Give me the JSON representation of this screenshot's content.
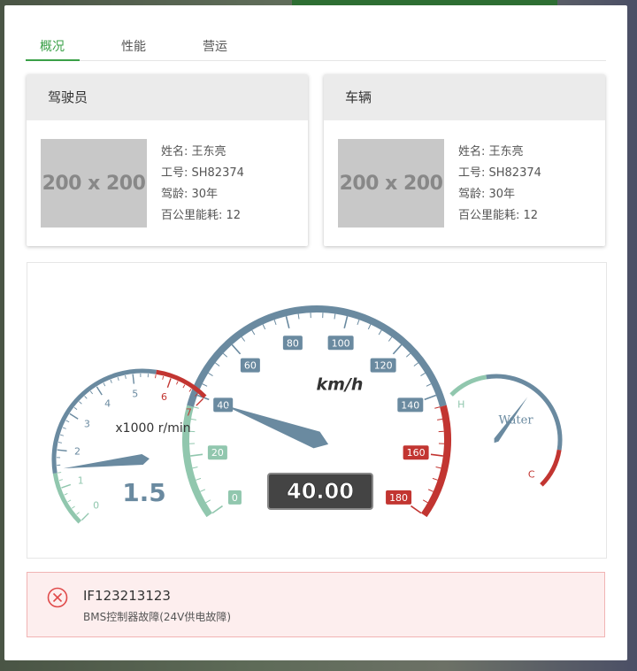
{
  "tabs": [
    {
      "label": "概况",
      "active": true
    },
    {
      "label": "性能",
      "active": false
    },
    {
      "label": "营运",
      "active": false
    }
  ],
  "driver_card": {
    "title": "驾驶员",
    "placeholder": "200 x 200",
    "fields": [
      "姓名: 王东亮",
      "工号: SH82374",
      "驾龄: 30年",
      "百公里能耗: 12"
    ]
  },
  "vehicle_card": {
    "title": "车辆",
    "placeholder": "200 x 200",
    "fields": [
      "姓名: 王东亮",
      "工号: SH82374",
      "驾龄: 30年",
      "百公里能耗: 12"
    ]
  },
  "gauges": {
    "rpm": {
      "unit": "x1000 r/min",
      "value": 1.5,
      "value_label": "1.5",
      "min": 0,
      "max": 7,
      "ticks": [
        "0",
        "1",
        "2",
        "3",
        "4",
        "5",
        "6",
        "7"
      ]
    },
    "speed": {
      "unit": "km/h",
      "value": 40,
      "value_label": "40.00",
      "min": 0,
      "max": 180,
      "ticks": [
        "0",
        "20",
        "40",
        "60",
        "80",
        "100",
        "120",
        "140",
        "160",
        "180"
      ]
    },
    "water": {
      "title": "Water",
      "high_label": "H",
      "low_label": "C",
      "value": 0.45
    },
    "colors": {
      "normal": "#6a8aa0",
      "low": "#91c7ae",
      "danger": "#c23531"
    }
  },
  "alert": {
    "code": "IF123213123",
    "message": "BMS控制器故障(24V供电故障)",
    "color": "#e04a4a"
  }
}
